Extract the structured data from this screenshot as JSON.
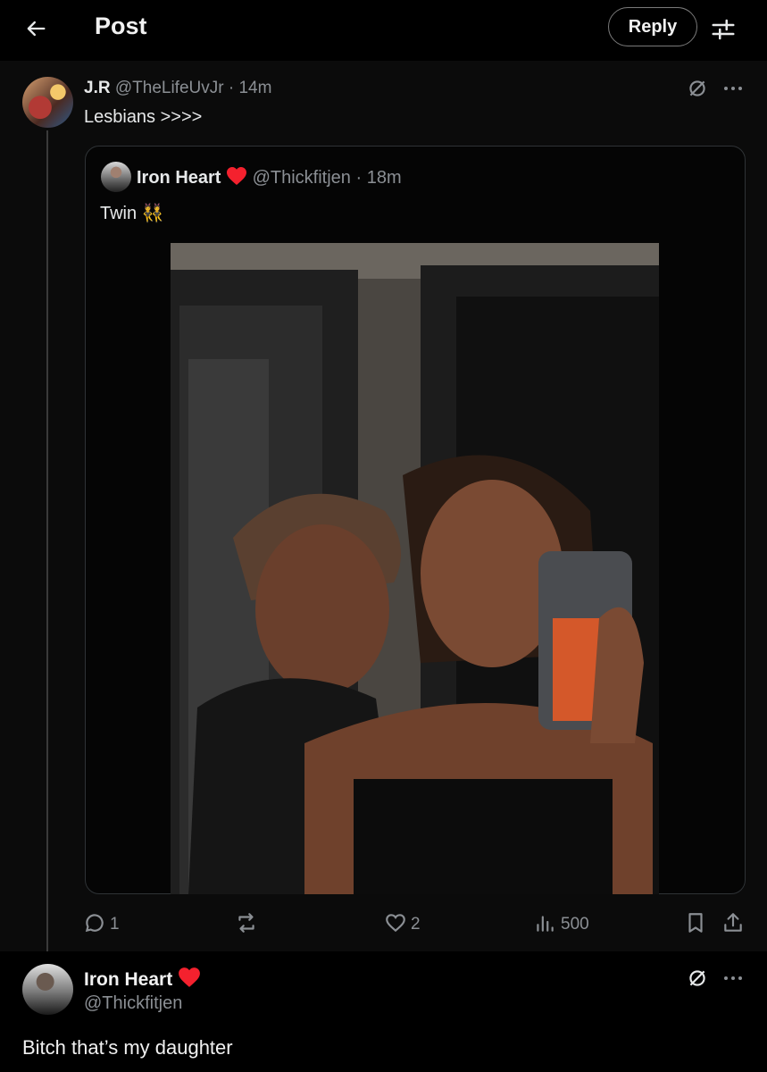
{
  "header": {
    "title": "Post",
    "reply_label": "Reply"
  },
  "parent_post": {
    "name": "J.R",
    "handle": "@TheLifeUvJr · 14m",
    "text": "Lesbians >>>>"
  },
  "quoted_post": {
    "name": "Iron Heart",
    "handle": "@Thickfitjen · 18m",
    "text": "Twin 👯"
  },
  "actions": {
    "replies": "1",
    "likes": "2",
    "views": "500"
  },
  "reply_post": {
    "name": "Iron Heart",
    "handle": "@Thickfitjen",
    "text": "Bitch that’s my daughter"
  },
  "colors": {
    "background": "#000000",
    "muted_text": "#8b8f94",
    "heart": "#f4212e",
    "border": "#2f3336"
  },
  "icons": [
    "back-arrow-icon",
    "filter-icon",
    "no-image-icon",
    "more-icon",
    "heart-icon",
    "reply-icon",
    "repost-icon",
    "like-icon",
    "views-icon",
    "bookmark-icon",
    "share-icon"
  ]
}
